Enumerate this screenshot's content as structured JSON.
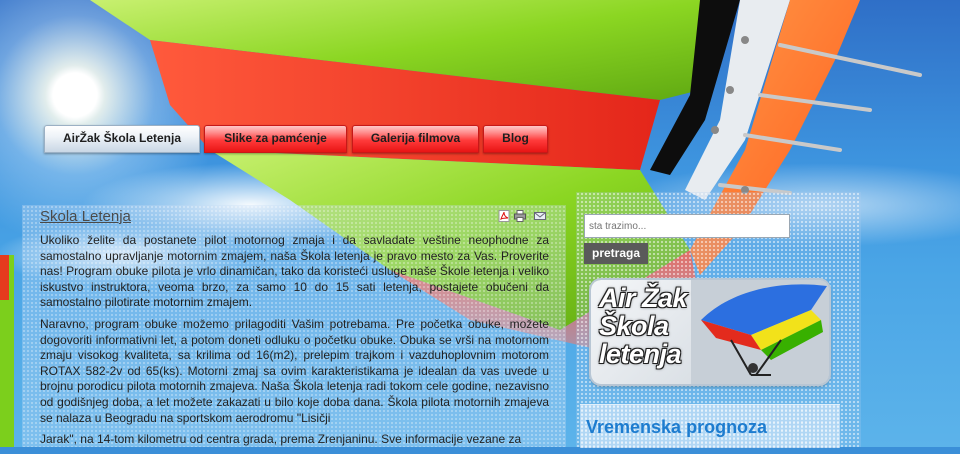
{
  "nav": {
    "items": [
      {
        "label": "AirŽak Škola Letenja",
        "active": true
      },
      {
        "label": "Slike za pamćenje",
        "active": false
      },
      {
        "label": "Galerija filmova",
        "active": false
      },
      {
        "label": "Blog",
        "active": false
      }
    ]
  },
  "article": {
    "title": "Skola Letenja",
    "tools": [
      "pdf-icon",
      "print-icon",
      "email-icon"
    ],
    "paragraphs": [
      "Ukoliko želite da postanete pilot motornog zmaja i da savladate veštine neophodne za samostalno upravljanje motornim zmajem, naša Škola letenja je pravo mesto za Vas. Proverite nas! Program obuke pilota je vrlo dinamičan, tako da koristeći usluge naše Škole letenja i veliko iskustvo instruktora, veoma brzo, za samo 10 do 15 sati letenja, postajete obučeni da samostalno pilotirate motornim zmajem.",
      "Naravno, program obuke možemo prilagoditi Vašim potrebama. Pre početka obuke, možete dogovoriti informativni let, a potom doneti odluku o početku obuke. Obuka se vrši na motornom zmaju visokog kvaliteta, sa krilima od 16(m2), prelepim trajkom i vazduhoplovnim motorom ROTAX 582-2v od 65(ks). Motorni zmaj sa ovim karakteristikama je idealan da vas uvede u brojnu porodicu pilota motornih zmajeva. Naša Škola letenja radi tokom cele godine, nezavisno od godišnjeg doba, a let možete zakazati u bilo koje doba dana. Škola pilota motornih zmajeva se nalaza u Beogradu na sportskom aerodromu \"Lisičji",
      "Jarak\", na 14-tom kilometru od centra grada, prema Zrenjaninu. Sve informacije vezane za"
    ]
  },
  "search": {
    "placeholder": "sta trazimo...",
    "button_label": "pretraga"
  },
  "promo": {
    "line1": "Air Žak",
    "line2": "Škola",
    "line3": "letenja"
  },
  "weather": {
    "title": "Vremenska prognoza"
  },
  "colors": {
    "nav_red": "#e81414",
    "weather_title": "#1d7ccf",
    "search_button": "#5a5a5a"
  }
}
